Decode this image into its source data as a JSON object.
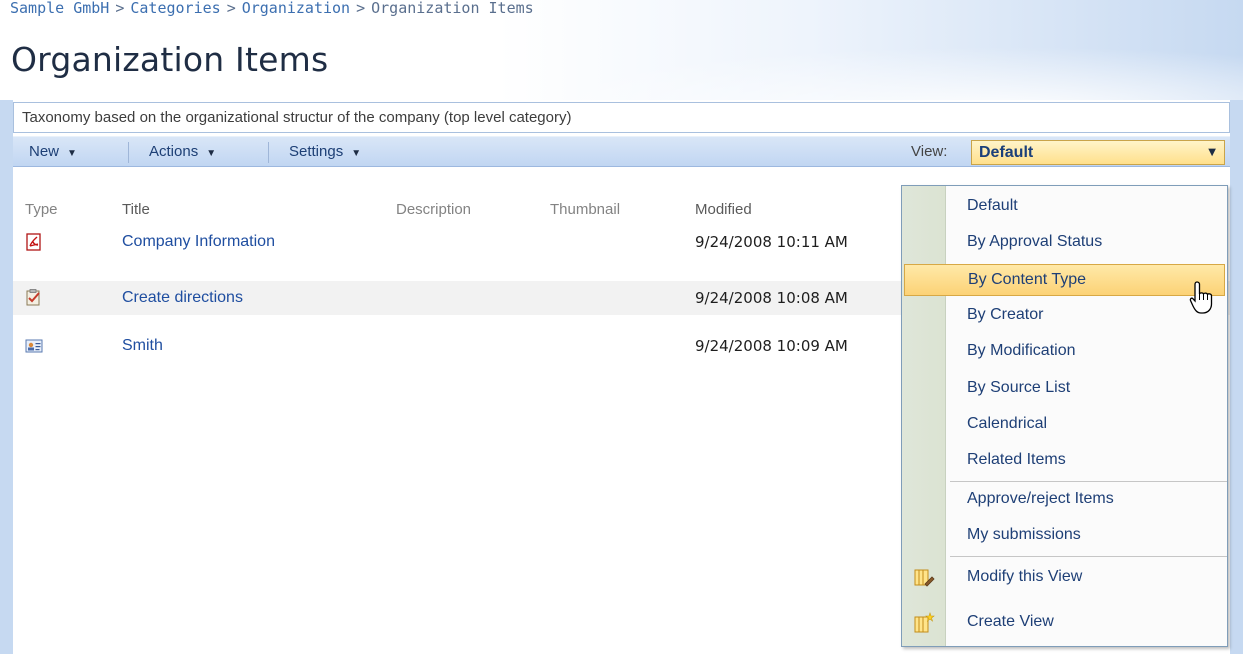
{
  "breadcrumb": {
    "items": [
      "Sample GmbH",
      "Categories",
      "Organization",
      "Organization Items"
    ],
    "separator": ">"
  },
  "page": {
    "title": "Organization Items",
    "description": "Taxonomy based on the organizational structur of the company (top level category)"
  },
  "toolbar": {
    "new_label": "New",
    "actions_label": "Actions",
    "settings_label": "Settings",
    "view_label": "View:",
    "view_selected": "Default"
  },
  "list": {
    "columns": {
      "type": "Type",
      "title": "Title",
      "description": "Description",
      "thumbnail": "Thumbnail",
      "modified": "Modified"
    },
    "rows": [
      {
        "icon": "pdf-icon",
        "title": "Company Information",
        "modified": "9/24/2008 10:11 AM"
      },
      {
        "icon": "task-icon",
        "title": "Create directions",
        "modified": "9/24/2008 10:08 AM"
      },
      {
        "icon": "contact-card-icon",
        "title": "Smith",
        "modified": "9/24/2008 10:09 AM"
      }
    ]
  },
  "view_menu": {
    "items": [
      "Default",
      "By Approval Status",
      "By Content Type",
      "By Creator",
      "By Modification",
      "By Source List",
      "Calendrical",
      "Related Items",
      "Approve/reject Items",
      "My submissions"
    ],
    "selected": "By Content Type",
    "modify_view": "Modify this View",
    "create_view": "Create View"
  },
  "colors": {
    "link": "#1f4ea0",
    "toolbar_bg": "#c1d6f2",
    "highlight": "#fcd276",
    "title_text": "#1f2d44"
  }
}
